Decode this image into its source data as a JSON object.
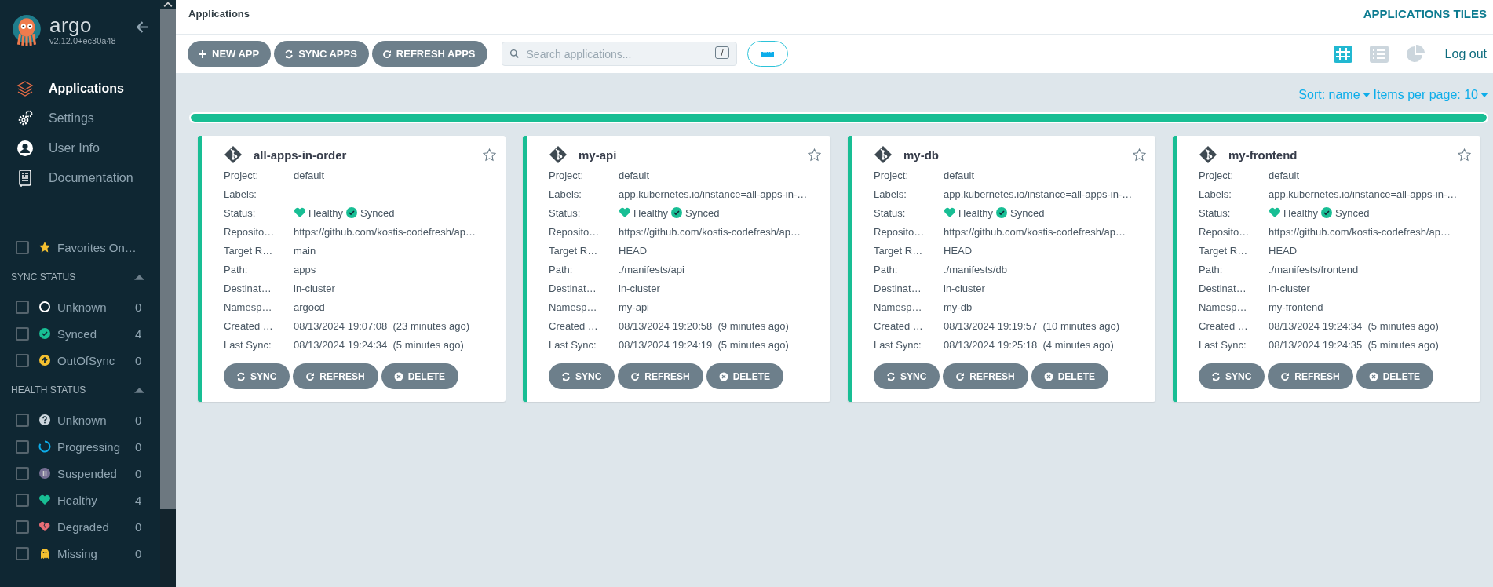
{
  "sidebar": {
    "logo_text": "argo",
    "version": "v2.12.0+ec30a48",
    "nav": [
      {
        "label": "Applications",
        "kind": "layers",
        "selected": true
      },
      {
        "label": "Settings",
        "kind": "gear",
        "selected": false
      },
      {
        "label": "User Info",
        "kind": "user",
        "selected": false
      },
      {
        "label": "Documentation",
        "kind": "book",
        "selected": false
      }
    ],
    "favorites": {
      "label": "Favorites On…",
      "checked": false
    },
    "filters": [
      {
        "title": "SYNC STATUS",
        "expanded": true,
        "items": [
          {
            "label": "Unknown",
            "kind": "sync-unknown",
            "count": "0",
            "checked": false
          },
          {
            "label": "Synced",
            "kind": "synced",
            "count": "4",
            "checked": false
          },
          {
            "label": "OutOfSync",
            "kind": "outofsync",
            "count": "0",
            "checked": false
          }
        ]
      },
      {
        "title": "HEALTH STATUS",
        "expanded": true,
        "items": [
          {
            "label": "Unknown",
            "kind": "health-unknown",
            "count": "0",
            "checked": false
          },
          {
            "label": "Progressing",
            "kind": "progressing",
            "count": "0",
            "checked": false
          },
          {
            "label": "Suspended",
            "kind": "suspended",
            "count": "0",
            "checked": false
          },
          {
            "label": "Healthy",
            "kind": "healthy",
            "count": "4",
            "checked": false
          },
          {
            "label": "Degraded",
            "kind": "degraded",
            "count": "0",
            "checked": false
          },
          {
            "label": "Missing",
            "kind": "missing",
            "count": "0",
            "checked": false
          }
        ]
      }
    ]
  },
  "header": {
    "breadcrumb": "Applications",
    "title": "APPLICATIONS TILES"
  },
  "toolbar": {
    "buttons": [
      {
        "label": "NEW APP",
        "kind": "plus"
      },
      {
        "label": "SYNC APPS",
        "kind": "sync"
      },
      {
        "label": "REFRESH APPS",
        "kind": "refresh"
      }
    ],
    "search": {
      "placeholder": "Search applications...",
      "shortcut": "/"
    },
    "views": [
      {
        "kind": "tiles",
        "selected": true
      },
      {
        "kind": "list",
        "selected": false
      },
      {
        "kind": "summary",
        "selected": false
      }
    ],
    "logout": "Log out"
  },
  "sort": {
    "sort_label": "Sort: name",
    "per_page_label": "Items per page: 10"
  },
  "health_bar": {
    "level": 1
  },
  "apps": [
    {
      "name": "all-apps-in-order",
      "favorite": false,
      "fields": [
        {
          "kind": "text",
          "label": "Project:",
          "value": "default"
        },
        {
          "kind": "text",
          "label": "Labels:"
        },
        {
          "kind": "status",
          "label": "Status:",
          "health": "Healthy",
          "sync": "Synced"
        },
        {
          "kind": "text",
          "label": "Reposito…",
          "value": "https://github.com/kostis-codefresh/ap…"
        },
        {
          "kind": "text",
          "label": "Target R…",
          "value": "main"
        },
        {
          "kind": "text",
          "label": "Path:",
          "value": "apps"
        },
        {
          "kind": "text",
          "label": "Destinat…",
          "value": "in-cluster"
        },
        {
          "kind": "text",
          "label": "Namesp…",
          "value": "argocd"
        },
        {
          "kind": "text",
          "label": "Created …",
          "value": "08/13/2024 19:07:08  (23 minutes ago)"
        },
        {
          "kind": "text",
          "label": "Last Sync:",
          "value": "08/13/2024 19:24:34  (5 minutes ago)"
        }
      ],
      "buttons": [
        {
          "label": "SYNC",
          "kind": "sync"
        },
        {
          "label": "REFRESH",
          "kind": "refresh"
        },
        {
          "label": "DELETE",
          "kind": "delete"
        }
      ]
    },
    {
      "name": "my-api",
      "favorite": false,
      "fields": [
        {
          "kind": "text",
          "label": "Project:",
          "value": "default"
        },
        {
          "kind": "text",
          "label": "Labels:",
          "value": "app.kubernetes.io/instance=all-apps-in-…"
        },
        {
          "kind": "status",
          "label": "Status:",
          "health": "Healthy",
          "sync": "Synced"
        },
        {
          "kind": "text",
          "label": "Reposito…",
          "value": "https://github.com/kostis-codefresh/ap…"
        },
        {
          "kind": "text",
          "label": "Target R…",
          "value": "HEAD"
        },
        {
          "kind": "text",
          "label": "Path:",
          "value": "./manifests/api"
        },
        {
          "kind": "text",
          "label": "Destinat…",
          "value": "in-cluster"
        },
        {
          "kind": "text",
          "label": "Namesp…",
          "value": "my-api"
        },
        {
          "kind": "text",
          "label": "Created …",
          "value": "08/13/2024 19:20:58  (9 minutes ago)"
        },
        {
          "kind": "text",
          "label": "Last Sync:",
          "value": "08/13/2024 19:24:19  (5 minutes ago)"
        }
      ],
      "buttons": [
        {
          "label": "SYNC",
          "kind": "sync"
        },
        {
          "label": "REFRESH",
          "kind": "refresh"
        },
        {
          "label": "DELETE",
          "kind": "delete"
        }
      ]
    },
    {
      "name": "my-db",
      "favorite": false,
      "fields": [
        {
          "kind": "text",
          "label": "Project:",
          "value": "default"
        },
        {
          "kind": "text",
          "label": "Labels:",
          "value": "app.kubernetes.io/instance=all-apps-in-…"
        },
        {
          "kind": "status",
          "label": "Status:",
          "health": "Healthy",
          "sync": "Synced"
        },
        {
          "kind": "text",
          "label": "Reposito…",
          "value": "https://github.com/kostis-codefresh/ap…"
        },
        {
          "kind": "text",
          "label": "Target R…",
          "value": "HEAD"
        },
        {
          "kind": "text",
          "label": "Path:",
          "value": "./manifests/db"
        },
        {
          "kind": "text",
          "label": "Destinat…",
          "value": "in-cluster"
        },
        {
          "kind": "text",
          "label": "Namesp…",
          "value": "my-db"
        },
        {
          "kind": "text",
          "label": "Created …",
          "value": "08/13/2024 19:19:57  (10 minutes ago)"
        },
        {
          "kind": "text",
          "label": "Last Sync:",
          "value": "08/13/2024 19:25:18  (4 minutes ago)"
        }
      ],
      "buttons": [
        {
          "label": "SYNC",
          "kind": "sync"
        },
        {
          "label": "REFRESH",
          "kind": "refresh"
        },
        {
          "label": "DELETE",
          "kind": "delete"
        }
      ]
    },
    {
      "name": "my-frontend",
      "favorite": false,
      "fields": [
        {
          "kind": "text",
          "label": "Project:",
          "value": "default"
        },
        {
          "kind": "text",
          "label": "Labels:",
          "value": "app.kubernetes.io/instance=all-apps-in-…"
        },
        {
          "kind": "status",
          "label": "Status:",
          "health": "Healthy",
          "sync": "Synced"
        },
        {
          "kind": "text",
          "label": "Reposito…",
          "value": "https://github.com/kostis-codefresh/ap…"
        },
        {
          "kind": "text",
          "label": "Target R…",
          "value": "HEAD"
        },
        {
          "kind": "text",
          "label": "Path:",
          "value": "./manifests/frontend"
        },
        {
          "kind": "text",
          "label": "Destinat…",
          "value": "in-cluster"
        },
        {
          "kind": "text",
          "label": "Namesp…",
          "value": "my-frontend"
        },
        {
          "kind": "text",
          "label": "Created …",
          "value": "08/13/2024 19:24:34  (5 minutes ago)"
        },
        {
          "kind": "text",
          "label": "Last Sync:",
          "value": "08/13/2024 19:24:35  (5 minutes ago)"
        }
      ],
      "buttons": [
        {
          "label": "SYNC",
          "kind": "sync"
        },
        {
          "label": "REFRESH",
          "kind": "refresh"
        },
        {
          "label": "DELETE",
          "kind": "delete"
        }
      ]
    }
  ]
}
